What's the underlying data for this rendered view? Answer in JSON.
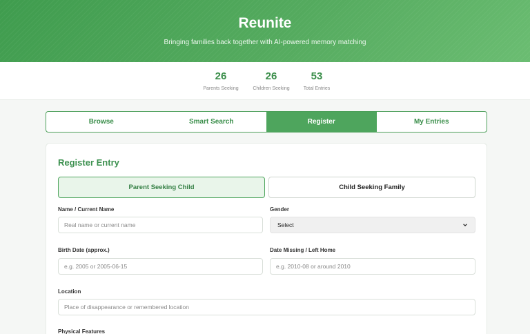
{
  "hero": {
    "title": "Reunite",
    "subtitle": "Bringing families back together with AI-powered memory matching"
  },
  "stats": [
    {
      "value": "26",
      "label": "Parents Seeking"
    },
    {
      "value": "26",
      "label": "Children Seeking"
    },
    {
      "value": "53",
      "label": "Total Entries"
    }
  ],
  "tabs": [
    {
      "label": "Browse"
    },
    {
      "label": "Smart Search"
    },
    {
      "label": "Register",
      "active": true
    },
    {
      "label": "My Entries"
    }
  ],
  "form": {
    "title": "Register Entry",
    "entry_types": [
      {
        "label": "Parent Seeking Child",
        "selected": true
      },
      {
        "label": "Child Seeking Family",
        "selected": false
      }
    ],
    "fields": {
      "name": {
        "label": "Name / Current Name",
        "placeholder": "Real name or current name",
        "value": ""
      },
      "gender": {
        "label": "Gender",
        "selected": "Select"
      },
      "birth_date": {
        "label": "Birth Date (approx.)",
        "placeholder": "e.g. 2005 or 2005-06-15",
        "value": ""
      },
      "date_missing": {
        "label": "Date Missing / Left Home",
        "placeholder": "e.g. 2010-08 or around 2010",
        "value": ""
      },
      "location": {
        "label": "Location",
        "placeholder": "Place of disappearance or remembered location",
        "value": ""
      },
      "physical_features": {
        "label": "Physical Features"
      }
    }
  },
  "colors": {
    "accent": "#4ea55d",
    "accent_dark": "#3a8e4a",
    "hero_start": "#3f9c4e",
    "hero_end": "#6bbd72"
  }
}
